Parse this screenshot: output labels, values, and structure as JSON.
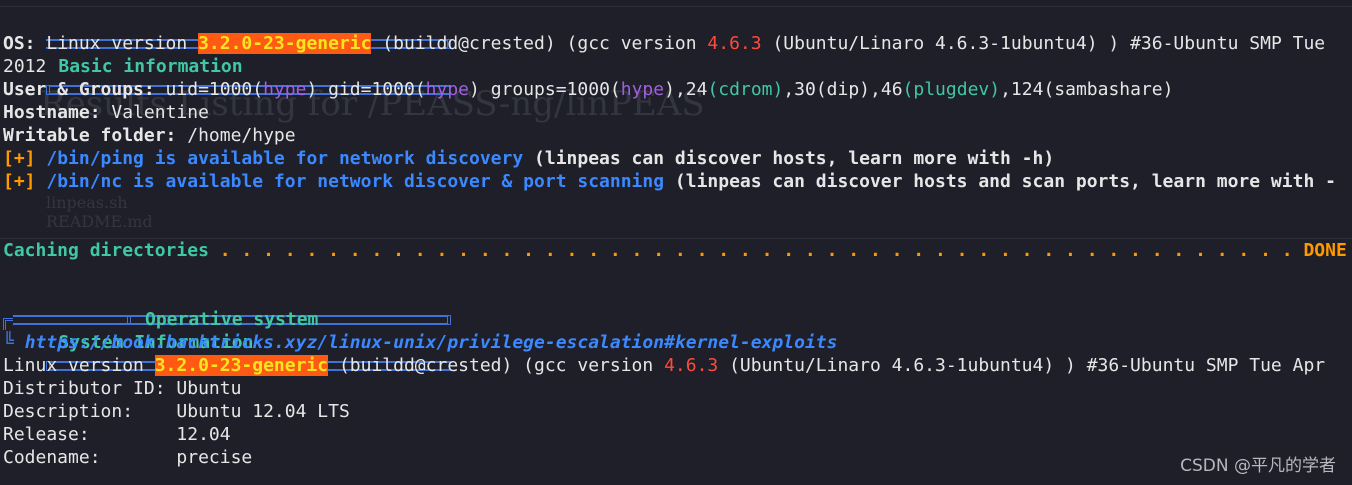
{
  "section_basic": "Basic information",
  "os": {
    "label": "OS:",
    "pre": " Linux version ",
    "kernel": "3.2.0-23-generic",
    "mid": " (buildd@crested) (gcc version ",
    "gcc": "4.6.3",
    "post": " (Ubuntu/Linaro 4.6.3-1ubuntu4) ) #36-Ubuntu SMP Tue",
    "wrap": "2012"
  },
  "users": {
    "label": "User & Groups:",
    "t1": " uid=1000(",
    "u1": "hype",
    "t2": ") gid=1000(",
    "u2": "hype",
    "t3": ") groups=1000(",
    "u3": "hype",
    "t4": "),24",
    "g1": "(cdrom)",
    "t5": ",30(dip),46",
    "g2": "(plugdev)",
    "t6": ",124(sambashare)"
  },
  "hostname": {
    "label": "Hostname:",
    "value": " Valentine"
  },
  "writable": {
    "label": "Writable folder:",
    "value": " /home/hype"
  },
  "ping": {
    "marker": "[+]",
    "text": " /bin/ping is available for network discovery",
    "note": " (linpeas can discover hosts, learn more with -h)"
  },
  "nc": {
    "marker": "[+]",
    "text": " /bin/nc is available for network discover & port scanning",
    "note": " (linpeas can discover hosts and scan ports, learn more with -"
  },
  "caching": {
    "label": "Caching directories",
    "dots": " . . . . . . . . . . . . . . . . . . . . . . . . . . . . . . . . . . . . . . . . . . . . . . . . . . ",
    "done": "DONE"
  },
  "section_system": "System Information",
  "subsection": "Operative system",
  "link": "https://book.hacktricks.xyz/linux-unix/privilege-escalation#kernel-exploits",
  "kernel_line": {
    "pre": "Linux version ",
    "kernel": "3.2.0-23-generic",
    "mid": " (buildd@crested) (gcc version ",
    "gcc": "4.6.3",
    "post": " (Ubuntu/Linaro 4.6.3-1ubuntu4) ) #36-Ubuntu SMP Tue Apr"
  },
  "lsb": [
    "Distributor ID: Ubuntu",
    "Description:    Ubuntu 12.04 LTS",
    "Release:        12.04",
    "Codename:       precise"
  ],
  "ghost": {
    "heading": "Results Listing for /PEASS-ng/linPEAS",
    "item1": "linpeas.sh",
    "item2": "README.md"
  },
  "watermark": "CSDN @平凡的学者"
}
